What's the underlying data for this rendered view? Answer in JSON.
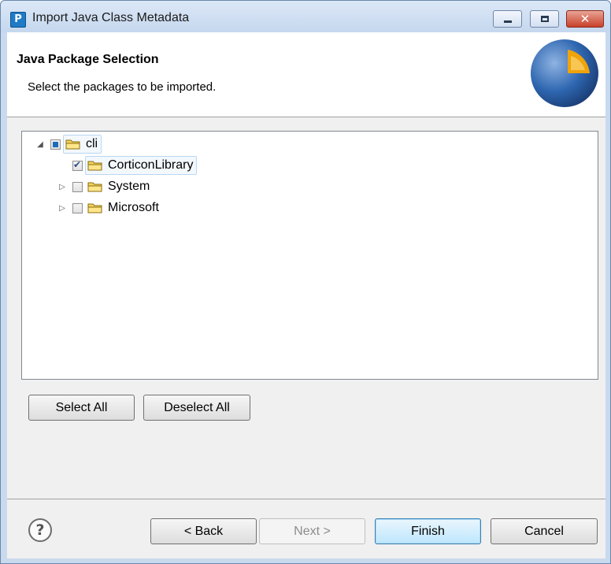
{
  "window": {
    "title": "Import Java Class Metadata",
    "app_icon_letter": "P",
    "controls": {
      "minimize": "minimize",
      "maximize": "maximize",
      "close": "✕"
    }
  },
  "header": {
    "title": "Java Package Selection",
    "description": "Select the packages to be imported."
  },
  "tree": {
    "root": {
      "label": "cli",
      "expanded": true,
      "check_state": "partial"
    },
    "children": [
      {
        "label": "CorticonLibrary",
        "expandable": false,
        "checked": true,
        "selected": true
      },
      {
        "label": "System",
        "expandable": true,
        "checked": false,
        "selected": false
      },
      {
        "label": "Microsoft",
        "expandable": true,
        "checked": false,
        "selected": false
      }
    ]
  },
  "selection_buttons": {
    "select_all": "Select All",
    "deselect_all": "Deselect All"
  },
  "footer": {
    "help": "?",
    "back": "< Back",
    "next": "Next >",
    "finish": "Finish",
    "cancel": "Cancel"
  },
  "colors": {
    "accent": "#3c7fb1",
    "titlebar": "#c5d7ee",
    "close_button": "#c8412b",
    "folder": "#f2d35a",
    "banner_blue": "#2e66b0",
    "banner_orange": "#f0a30a"
  }
}
